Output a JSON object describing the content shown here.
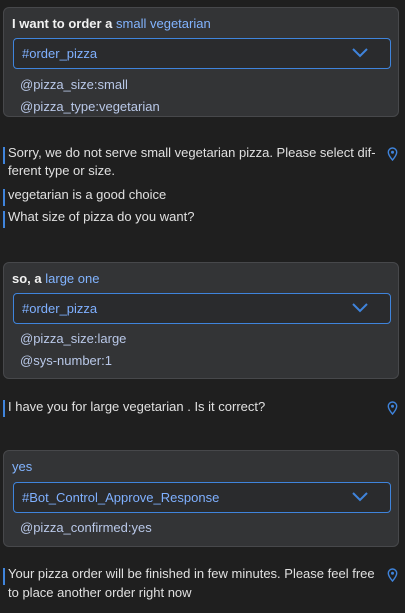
{
  "turns": [
    {
      "user": {
        "text": "I want to order a",
        "highlight": "small vegetarian"
      },
      "intent": "#order_pizza",
      "entities": [
        "@pizza_size:small",
        "@pizza_type:vegetarian"
      ]
    },
    {
      "user": {
        "text": "so, a",
        "highlight": "large one"
      },
      "intent": "#order_pizza",
      "entities": [
        "@pizza_size:large",
        "@sys-number:1"
      ]
    },
    {
      "user": {
        "text": "",
        "highlight": "yes"
      },
      "intent": "#Bot_Control_Approve_Response",
      "entities": [
        "@pizza_confirmed:yes"
      ]
    }
  ],
  "bot": {
    "msg1_line1": "Sorry, we do not serve small vegetarian pizza. Please select dif-",
    "msg1_line2": "ferent type or size.",
    "msg2": "vegetarian is a good choice",
    "msg3": "What size of pizza do you want?",
    "msg4": "I have you for large vegetarian . Is it correct?",
    "msg5_line1": "Your pizza order will be finished in few minutes. Please feel free",
    "msg5_line2": "to place another order right now"
  },
  "colors": {
    "accent": "#3f84dc",
    "highlight_text": "#82b4ff",
    "card_bg": "#333436",
    "page_bg": "#1f1f1f"
  },
  "icons": {
    "intent_dropdown": "chevron-down-icon",
    "message_location": "location-pin-icon"
  }
}
